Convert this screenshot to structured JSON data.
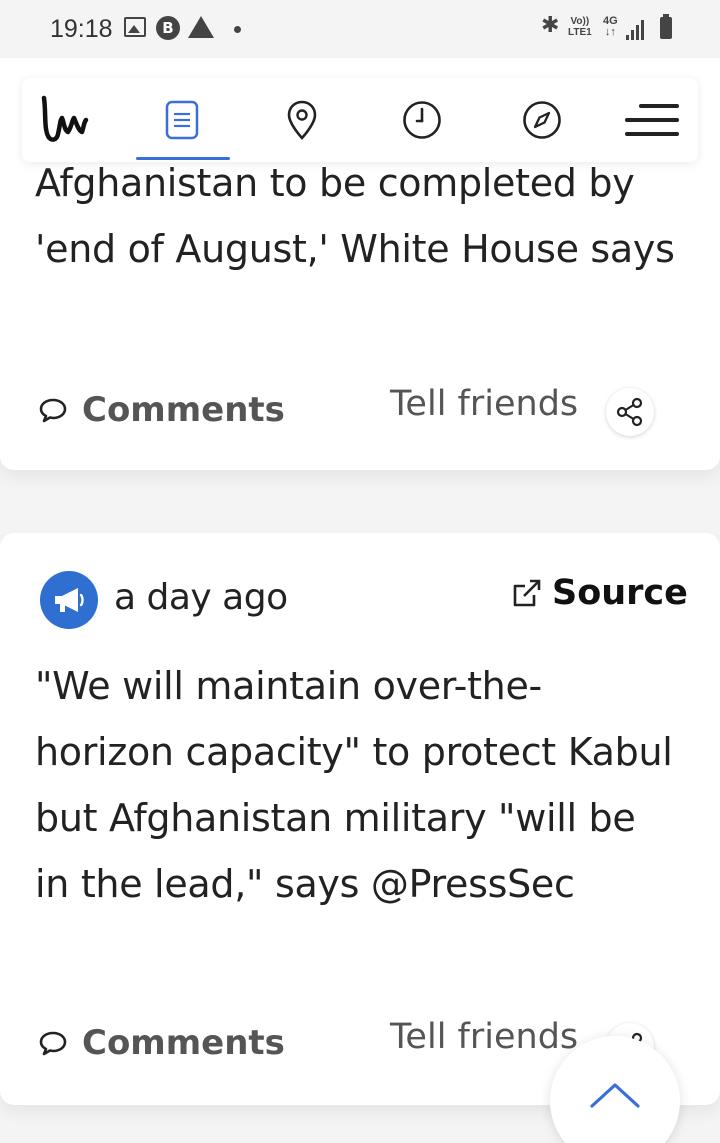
{
  "status_bar": {
    "time": "19:18",
    "volte_line1": "Vo))",
    "volte_line2": "LTE1",
    "network_line1": "4G",
    "network_line2": "↓↑"
  },
  "header": {
    "logo_icon": "liveuamap-logo",
    "nav": [
      {
        "name": "news-list",
        "icon": "list-icon",
        "active": true
      },
      {
        "name": "map",
        "icon": "map-pin-icon",
        "active": false
      },
      {
        "name": "timeline",
        "icon": "clock-icon",
        "active": false
      },
      {
        "name": "explore",
        "icon": "compass-icon",
        "active": false
      },
      {
        "name": "menu",
        "icon": "hamburger-menu-icon",
        "active": false
      }
    ],
    "accent_color": "#3a6fd8"
  },
  "cards": [
    {
      "headline": "Afghanistan to be completed by 'end of August,' White House says",
      "comments_label": "Comments",
      "tell_friends_label": "Tell friends"
    },
    {
      "timestamp": "a day ago",
      "source_label": "Source",
      "headline": "\"We will maintain over-the-horizon capacity\" to protect Kabul but Afghanistan military \"will be in the lead,\" says @PressSec",
      "comments_label": "Comments",
      "tell_friends_label": "Tell friends",
      "avatar_color": "#2f6fd1"
    }
  ]
}
